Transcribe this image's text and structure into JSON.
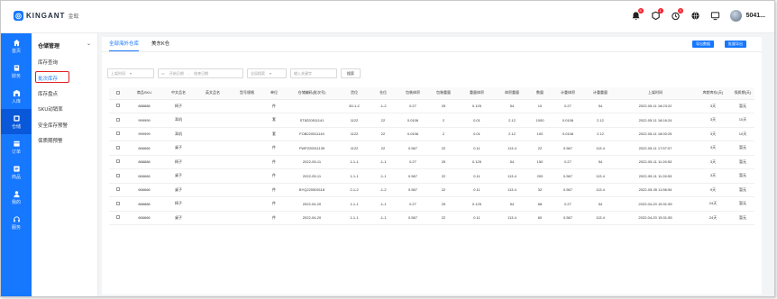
{
  "app": {
    "logo_text": "KINGANT",
    "logo_sub": "金蚁",
    "username": "5041..."
  },
  "header_badges": [
    "5",
    "1",
    "3"
  ],
  "rail": [
    {
      "label": "首页",
      "icon": "home-icon"
    },
    {
      "label": "财务",
      "icon": "finance-icon"
    },
    {
      "label": "入库",
      "icon": "inbound-icon"
    },
    {
      "label": "仓储",
      "icon": "warehouse-icon"
    },
    {
      "label": "订单",
      "icon": "order-icon"
    },
    {
      "label": "商品",
      "icon": "product-icon"
    },
    {
      "label": "我的",
      "icon": "user-icon"
    },
    {
      "label": "服务",
      "icon": "headset-icon"
    }
  ],
  "submenu": {
    "title": "仓储管理",
    "items": [
      {
        "label": "库存查询"
      },
      {
        "label": "批次库存"
      },
      {
        "label": "库存盘点"
      },
      {
        "label": "SKU动销率"
      },
      {
        "label": "安全库存预警"
      },
      {
        "label": "保质期预警"
      }
    ]
  },
  "tabs": [
    "全部海外仓库",
    "美东K仓"
  ],
  "buttons": {
    "export_data": "导出数据",
    "export_shelf": "批量导出"
  },
  "filters": {
    "time_select": "上架时间",
    "date_start": "开始日期",
    "date_end": "结束日期",
    "search_scope": "全局搜索",
    "search_placeholder": "输入关键字",
    "search_button": "搜索"
  },
  "table": {
    "columns": [
      "商品SKU",
      "中文品名",
      "英文品名",
      "型号规格",
      "单位",
      "仓储编码(批次号)",
      "货位",
      "仓位",
      "包装体积",
      "包装重量",
      "重量体积",
      "体积重量",
      "数量",
      "计重体积",
      "计重重量",
      "上架时间",
      "库龄库存(天)",
      "保质期(天)"
    ],
    "rows": [
      [
        "888888",
        "椅子",
        "",
        "",
        "件",
        "",
        "50-1-2",
        "-1-2",
        "0.27",
        "25",
        "0.125",
        "54",
        "10",
        "0.27",
        "54",
        "2022-05-11 18:23:22",
        "3天",
        "暂无"
      ],
      [
        "999999",
        "耳机",
        "",
        "",
        "套",
        "ST8220511141",
        "1122",
        "22",
        "0.0106",
        "2",
        "0.01",
        "2.12",
        "1000",
        "0.0106",
        "2.12",
        "2022-05-11 18:16:24",
        "3天",
        "10天"
      ],
      [
        "999999",
        "耳机",
        "",
        "",
        "套",
        "FOB220511140",
        "1122",
        "22",
        "0.0106",
        "2",
        "0.01",
        "2.12",
        "100",
        "0.0106",
        "2.12",
        "2022-05-11 18:00:25",
        "3天",
        "10天"
      ],
      [
        "666666",
        "桌子",
        "",
        "",
        "件",
        "FWP220511139",
        "1122",
        "22",
        "0.567",
        "22",
        "0.11",
        "113.4",
        "22",
        "0.567",
        "113.4",
        "2022-05-11 17:57:07",
        "3天",
        "暂无"
      ],
      [
        "888888",
        "椅子",
        "",
        "",
        "件",
        "2022-05-11",
        "1-1-1",
        "-1-1",
        "0.27",
        "25",
        "0.125",
        "54",
        "150",
        "0.27",
        "54",
        "2022-05-11 11:26:53",
        "3天",
        "暂无"
      ],
      [
        "666666",
        "桌子",
        "",
        "",
        "件",
        "2022-05-11",
        "1-1-1",
        "-1-1",
        "0.567",
        "22",
        "0.11",
        "113.4",
        "200",
        "0.567",
        "113.4",
        "2022-05-11 11:26:53",
        "3天",
        "暂无"
      ],
      [
        "666666",
        "桌子",
        "",
        "",
        "件",
        "BYQ220505118",
        "2-1-2",
        "-1-2",
        "0.567",
        "22",
        "0.11",
        "113.4",
        "32",
        "0.567",
        "113.4",
        "2022-05-05 11:56:54",
        "9天",
        "暂无"
      ],
      [
        "888888",
        "椅子",
        "",
        "",
        "件",
        "2022-04-20",
        "1-1-1",
        "-1-1",
        "0.27",
        "25",
        "0.125",
        "54",
        "68",
        "0.27",
        "54",
        "2022-04-20 15:31:55",
        "24天",
        "暂无"
      ],
      [
        "666666",
        "桌子",
        "",
        "",
        "件",
        "2022-04-20",
        "1-1-1",
        "-1-1",
        "0.567",
        "22",
        "0.11",
        "113.4",
        "60",
        "0.567",
        "113.4",
        "2022-04-20 15:31:55",
        "24天",
        "暂无"
      ]
    ]
  },
  "colors": {
    "brand": "#1677ff",
    "highlight": "#e02020"
  }
}
